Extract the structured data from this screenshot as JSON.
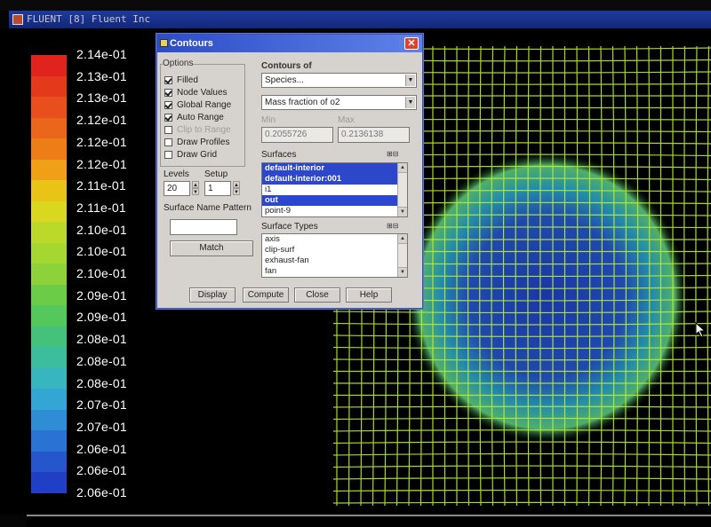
{
  "window": {
    "title": "FLUENT [8] Fluent Inc"
  },
  "legend": {
    "labels": [
      "2.14e-01",
      "2.13e-01",
      "2.13e-01",
      "2.12e-01",
      "2.12e-01",
      "2.12e-01",
      "2.11e-01",
      "2.11e-01",
      "2.10e-01",
      "2.10e-01",
      "2.10e-01",
      "2.09e-01",
      "2.09e-01",
      "2.08e-01",
      "2.08e-01",
      "2.08e-01",
      "2.07e-01",
      "2.07e-01",
      "2.06e-01",
      "2.06e-01",
      "2.06e-01"
    ],
    "colors": [
      "#e0231c",
      "#e43a1c",
      "#e84f1c",
      "#e9661a",
      "#ec7d17",
      "#f0a016",
      "#e9c417",
      "#d9d71f",
      "#bcd92a",
      "#a4d830",
      "#8dd238",
      "#6ccc48",
      "#55c85c",
      "#44c27c",
      "#3cbd9e",
      "#38b6bf",
      "#34a6d3",
      "#2f8dd6",
      "#2a72d4",
      "#2556cc",
      "#1f3fc4"
    ]
  },
  "mesh": {
    "line_color": "#b9ef3a",
    "inner_color": "#1538b0"
  },
  "dialog": {
    "title": "Contours",
    "close_label": "✕",
    "options": {
      "label": "Options",
      "items": [
        {
          "label": "Filled",
          "checked": true,
          "enabled": true
        },
        {
          "label": "Node Values",
          "checked": true,
          "enabled": true
        },
        {
          "label": "Global Range",
          "checked": true,
          "enabled": true
        },
        {
          "label": "Auto Range",
          "checked": true,
          "enabled": true
        },
        {
          "label": "Clip to Range",
          "checked": false,
          "enabled": false
        },
        {
          "label": "Draw Profiles",
          "checked": false,
          "enabled": true
        },
        {
          "label": "Draw Grid",
          "checked": false,
          "enabled": true
        }
      ]
    },
    "levels": {
      "label": "Levels",
      "value": "20"
    },
    "setup": {
      "label": "Setup",
      "value": "1"
    },
    "surface_name_pattern": {
      "label": "Surface Name Pattern",
      "value": "",
      "match_label": "Match"
    },
    "contours_of": {
      "label": "Contours of",
      "category": "Species...",
      "variable": "Mass fraction of o2"
    },
    "min": {
      "label": "Min",
      "value": "0.2055726"
    },
    "max": {
      "label": "Max",
      "value": "0.2136138"
    },
    "surfaces": {
      "label": "Surfaces",
      "items": [
        {
          "label": "default-interior",
          "selected": true
        },
        {
          "label": "default-interior:001",
          "selected": true
        },
        {
          "label": "i1",
          "selected": false
        },
        {
          "label": "out",
          "selected": true
        },
        {
          "label": "point-9",
          "selected": false
        }
      ]
    },
    "surface_types": {
      "label": "Surface Types",
      "items": [
        {
          "label": "axis"
        },
        {
          "label": "clip-surf"
        },
        {
          "label": "exhaust-fan"
        },
        {
          "label": "fan"
        }
      ]
    },
    "buttons": {
      "display": "Display",
      "compute": "Compute",
      "close": "Close",
      "help": "Help"
    }
  }
}
